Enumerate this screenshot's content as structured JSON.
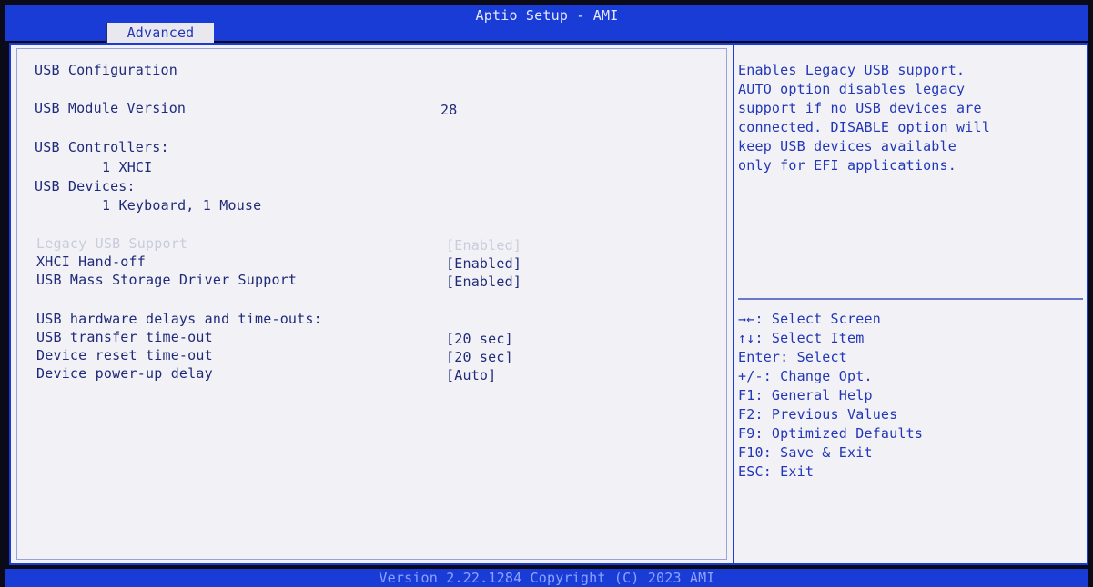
{
  "header": {
    "title": "Aptio Setup - AMI",
    "active_tab": "Advanced"
  },
  "left": {
    "section_title": "USB Configuration",
    "module_version_label": "USB Module Version",
    "module_version_value": "28",
    "controllers_label": "USB Controllers:",
    "controllers_value": "1 XHCI",
    "devices_label": "USB Devices:",
    "devices_value": "1 Keyboard, 1 Mouse",
    "settings": [
      {
        "label": "Legacy USB Support",
        "value": "[Enabled]",
        "selected": true
      },
      {
        "label": "XHCI Hand-off",
        "value": "[Enabled]",
        "selected": false
      },
      {
        "label": "USB Mass Storage Driver Support",
        "value": "[Enabled]",
        "selected": false
      }
    ],
    "delays_title": "USB hardware delays and time-outs:",
    "delays": [
      {
        "label": "USB transfer time-out",
        "value": "[20 sec]"
      },
      {
        "label": "Device reset time-out",
        "value": "[20 sec]"
      },
      {
        "label": "Device power-up delay",
        "value": "[Auto]"
      }
    ]
  },
  "help": {
    "lines": [
      "Enables Legacy USB support.",
      "AUTO option disables legacy",
      "support if no USB devices are",
      "connected. DISABLE option will",
      "keep USB devices available",
      "only for EFI applications."
    ]
  },
  "keys": [
    "→←: Select Screen",
    "↑↓: Select Item",
    "Enter: Select",
    "+/-: Change Opt.",
    "F1: General Help",
    "F2: Previous Values",
    "F9: Optimized Defaults",
    "F10: Save & Exit",
    "ESC: Exit"
  ],
  "footer": {
    "text": "Version 2.22.1284 Copyright (C) 2023 AMI"
  }
}
